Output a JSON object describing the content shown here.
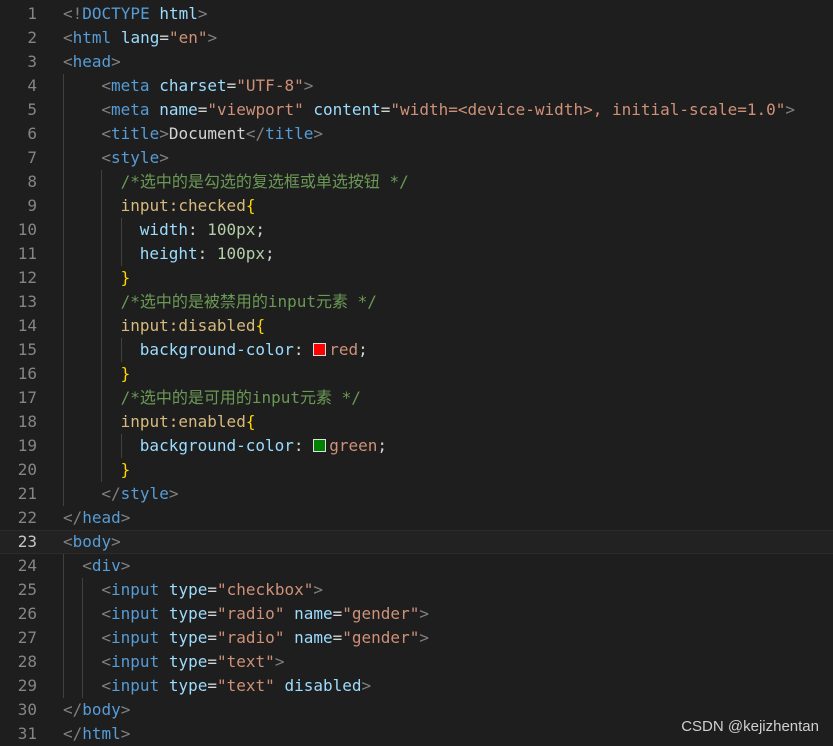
{
  "editor": {
    "lines": [
      {
        "n": "1",
        "indent": 0,
        "guides": [],
        "tokens": [
          [
            "punct",
            "<!"
          ],
          [
            "tag",
            "DOCTYPE"
          ],
          [
            "text",
            " "
          ],
          [
            "attr",
            "html"
          ],
          [
            "punct",
            ">"
          ]
        ]
      },
      {
        "n": "2",
        "indent": 0,
        "guides": [],
        "tokens": [
          [
            "punct",
            "<"
          ],
          [
            "tag",
            "html"
          ],
          [
            "text",
            " "
          ],
          [
            "attr",
            "lang"
          ],
          [
            "text",
            "="
          ],
          [
            "str",
            "\"en\""
          ],
          [
            "punct",
            ">"
          ]
        ]
      },
      {
        "n": "3",
        "indent": 0,
        "guides": [],
        "tokens": [
          [
            "punct",
            "<"
          ],
          [
            "tag",
            "head"
          ],
          [
            "punct",
            ">"
          ]
        ]
      },
      {
        "n": "4",
        "indent": 4,
        "guides": [
          0
        ],
        "tokens": [
          [
            "punct",
            "<"
          ],
          [
            "tag",
            "meta"
          ],
          [
            "text",
            " "
          ],
          [
            "attr",
            "charset"
          ],
          [
            "text",
            "="
          ],
          [
            "str",
            "\"UTF-8\""
          ],
          [
            "punct",
            ">"
          ]
        ]
      },
      {
        "n": "5",
        "indent": 4,
        "guides": [
          0
        ],
        "tokens": [
          [
            "punct",
            "<"
          ],
          [
            "tag",
            "meta"
          ],
          [
            "text",
            " "
          ],
          [
            "attr",
            "name"
          ],
          [
            "text",
            "="
          ],
          [
            "str",
            "\"viewport\""
          ],
          [
            "text",
            " "
          ],
          [
            "attr",
            "content"
          ],
          [
            "text",
            "="
          ],
          [
            "str",
            "\"width=<device-width>, initial-scale=1.0\""
          ],
          [
            "punct",
            ">"
          ]
        ]
      },
      {
        "n": "6",
        "indent": 4,
        "guides": [
          0
        ],
        "tokens": [
          [
            "punct",
            "<"
          ],
          [
            "tag",
            "title"
          ],
          [
            "punct",
            ">"
          ],
          [
            "text",
            "Document"
          ],
          [
            "punct",
            "</"
          ],
          [
            "tag",
            "title"
          ],
          [
            "punct",
            ">"
          ]
        ]
      },
      {
        "n": "7",
        "indent": 4,
        "guides": [
          0
        ],
        "tokens": [
          [
            "punct",
            "<"
          ],
          [
            "tag",
            "style"
          ],
          [
            "punct",
            ">"
          ]
        ]
      },
      {
        "n": "8",
        "indent": 6,
        "guides": [
          0,
          4
        ],
        "tokens": [
          [
            "comment",
            "/*选中的是勾选的复选框或单选按钮 */"
          ]
        ]
      },
      {
        "n": "9",
        "indent": 6,
        "guides": [
          0,
          4
        ],
        "tokens": [
          [
            "sel",
            "input:checked"
          ],
          [
            "brace",
            "{"
          ]
        ]
      },
      {
        "n": "10",
        "indent": 8,
        "guides": [
          0,
          4,
          6
        ],
        "tokens": [
          [
            "prop",
            "width"
          ],
          [
            "text",
            ": "
          ],
          [
            "num",
            "100px"
          ],
          [
            "text",
            ";"
          ]
        ]
      },
      {
        "n": "11",
        "indent": 8,
        "guides": [
          0,
          4,
          6
        ],
        "tokens": [
          [
            "prop",
            "height"
          ],
          [
            "text",
            ": "
          ],
          [
            "num",
            "100px"
          ],
          [
            "text",
            ";"
          ]
        ]
      },
      {
        "n": "12",
        "indent": 6,
        "guides": [
          0,
          4
        ],
        "tokens": [
          [
            "brace",
            "}"
          ]
        ]
      },
      {
        "n": "13",
        "indent": 6,
        "guides": [
          0,
          4
        ],
        "tokens": [
          [
            "comment",
            "/*选中的是被禁用的input元素 */"
          ]
        ]
      },
      {
        "n": "14",
        "indent": 6,
        "guides": [
          0,
          4
        ],
        "tokens": [
          [
            "sel",
            "input:disabled"
          ],
          [
            "brace",
            "{"
          ]
        ]
      },
      {
        "n": "15",
        "indent": 8,
        "guides": [
          0,
          4,
          6
        ],
        "tokens": [
          [
            "prop",
            "background-color"
          ],
          [
            "text",
            ": "
          ],
          [
            "swatch",
            "#ff0000"
          ],
          [
            "val",
            "red"
          ],
          [
            "text",
            ";"
          ]
        ]
      },
      {
        "n": "16",
        "indent": 6,
        "guides": [
          0,
          4
        ],
        "tokens": [
          [
            "brace",
            "}"
          ]
        ]
      },
      {
        "n": "17",
        "indent": 6,
        "guides": [
          0,
          4
        ],
        "tokens": [
          [
            "comment",
            "/*选中的是可用的input元素 */"
          ]
        ]
      },
      {
        "n": "18",
        "indent": 6,
        "guides": [
          0,
          4
        ],
        "tokens": [
          [
            "sel",
            "input:enabled"
          ],
          [
            "brace",
            "{"
          ]
        ]
      },
      {
        "n": "19",
        "indent": 8,
        "guides": [
          0,
          4,
          6
        ],
        "tokens": [
          [
            "prop",
            "background-color"
          ],
          [
            "text",
            ": "
          ],
          [
            "swatch",
            "#008000"
          ],
          [
            "val",
            "green"
          ],
          [
            "text",
            ";"
          ]
        ]
      },
      {
        "n": "20",
        "indent": 6,
        "guides": [
          0,
          4
        ],
        "tokens": [
          [
            "brace",
            "}"
          ]
        ]
      },
      {
        "n": "21",
        "indent": 4,
        "guides": [
          0
        ],
        "tokens": [
          [
            "punct",
            "</"
          ],
          [
            "tag",
            "style"
          ],
          [
            "punct",
            ">"
          ]
        ]
      },
      {
        "n": "22",
        "indent": 0,
        "guides": [],
        "tokens": [
          [
            "punct",
            "</"
          ],
          [
            "tag",
            "head"
          ],
          [
            "punct",
            ">"
          ]
        ]
      },
      {
        "n": "23",
        "indent": 0,
        "guides": [],
        "current": true,
        "tokens": [
          [
            "punct",
            "<"
          ],
          [
            "tag",
            "body"
          ],
          [
            "punct",
            ">"
          ]
        ]
      },
      {
        "n": "24",
        "indent": 2,
        "guides": [
          0
        ],
        "tokens": [
          [
            "punct",
            "<"
          ],
          [
            "tag",
            "div"
          ],
          [
            "punct",
            ">"
          ]
        ]
      },
      {
        "n": "25",
        "indent": 4,
        "guides": [
          0,
          2
        ],
        "tokens": [
          [
            "punct",
            "<"
          ],
          [
            "tag",
            "input"
          ],
          [
            "text",
            " "
          ],
          [
            "attr",
            "type"
          ],
          [
            "text",
            "="
          ],
          [
            "str",
            "\"checkbox\""
          ],
          [
            "punct",
            ">"
          ]
        ]
      },
      {
        "n": "26",
        "indent": 4,
        "guides": [
          0,
          2
        ],
        "tokens": [
          [
            "punct",
            "<"
          ],
          [
            "tag",
            "input"
          ],
          [
            "text",
            " "
          ],
          [
            "attr",
            "type"
          ],
          [
            "text",
            "="
          ],
          [
            "str",
            "\"radio\""
          ],
          [
            "text",
            " "
          ],
          [
            "attr",
            "name"
          ],
          [
            "text",
            "="
          ],
          [
            "str",
            "\"gender\""
          ],
          [
            "punct",
            ">"
          ]
        ]
      },
      {
        "n": "27",
        "indent": 4,
        "guides": [
          0,
          2
        ],
        "tokens": [
          [
            "punct",
            "<"
          ],
          [
            "tag",
            "input"
          ],
          [
            "text",
            " "
          ],
          [
            "attr",
            "type"
          ],
          [
            "text",
            "="
          ],
          [
            "str",
            "\"radio\""
          ],
          [
            "text",
            " "
          ],
          [
            "attr",
            "name"
          ],
          [
            "text",
            "="
          ],
          [
            "str",
            "\"gender\""
          ],
          [
            "punct",
            ">"
          ]
        ]
      },
      {
        "n": "28",
        "indent": 4,
        "guides": [
          0,
          2
        ],
        "tokens": [
          [
            "punct",
            "<"
          ],
          [
            "tag",
            "input"
          ],
          [
            "text",
            " "
          ],
          [
            "attr",
            "type"
          ],
          [
            "text",
            "="
          ],
          [
            "str",
            "\"text\""
          ],
          [
            "punct",
            ">"
          ]
        ]
      },
      {
        "n": "29",
        "indent": 4,
        "guides": [
          0,
          2
        ],
        "tokens": [
          [
            "punct",
            "<"
          ],
          [
            "tag",
            "input"
          ],
          [
            "text",
            " "
          ],
          [
            "attr",
            "type"
          ],
          [
            "text",
            "="
          ],
          [
            "str",
            "\"text\""
          ],
          [
            "text",
            " "
          ],
          [
            "attr",
            "disabled"
          ],
          [
            "punct",
            ">"
          ]
        ]
      },
      {
        "n": "30",
        "indent": 0,
        "guides": [],
        "tokens": [
          [
            "punct",
            "</"
          ],
          [
            "tag",
            "body"
          ],
          [
            "punct",
            ">"
          ]
        ]
      },
      {
        "n": "31",
        "indent": 0,
        "guides": [],
        "tokens": [
          [
            "punct",
            "</"
          ],
          [
            "tag",
            "html"
          ],
          [
            "punct",
            ">"
          ]
        ]
      }
    ]
  },
  "watermark": "CSDN @kejizhentan"
}
